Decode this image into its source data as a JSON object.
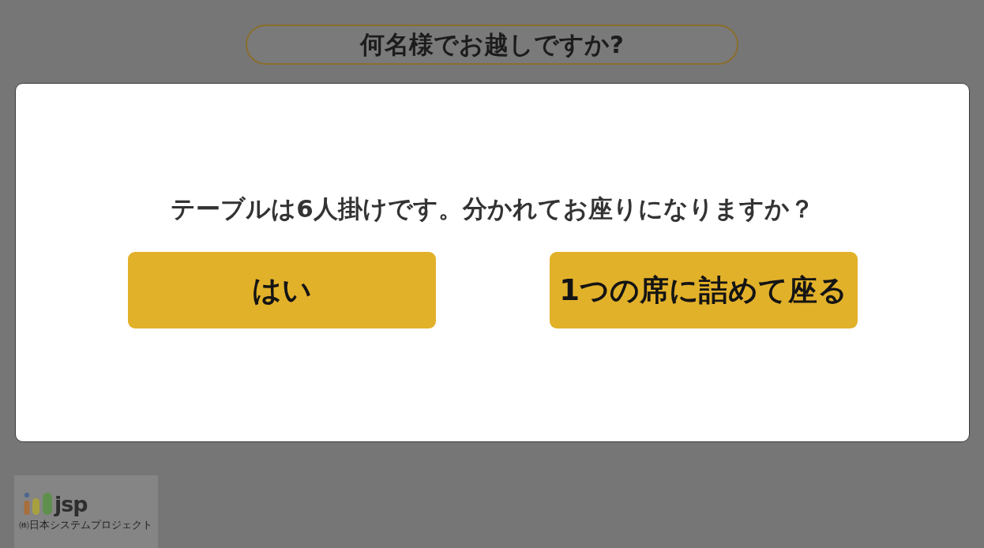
{
  "header": {
    "title": "何名様でお越しですか?"
  },
  "dialog": {
    "message": "テーブルは6人掛けです。分かれてお座りになりますか？",
    "buttons": [
      {
        "label": "はい"
      },
      {
        "label": "1つの席に詰めて座る"
      }
    ]
  },
  "logo": {
    "mark": "jsp",
    "company": "㈱日本システムプロジェクト"
  }
}
